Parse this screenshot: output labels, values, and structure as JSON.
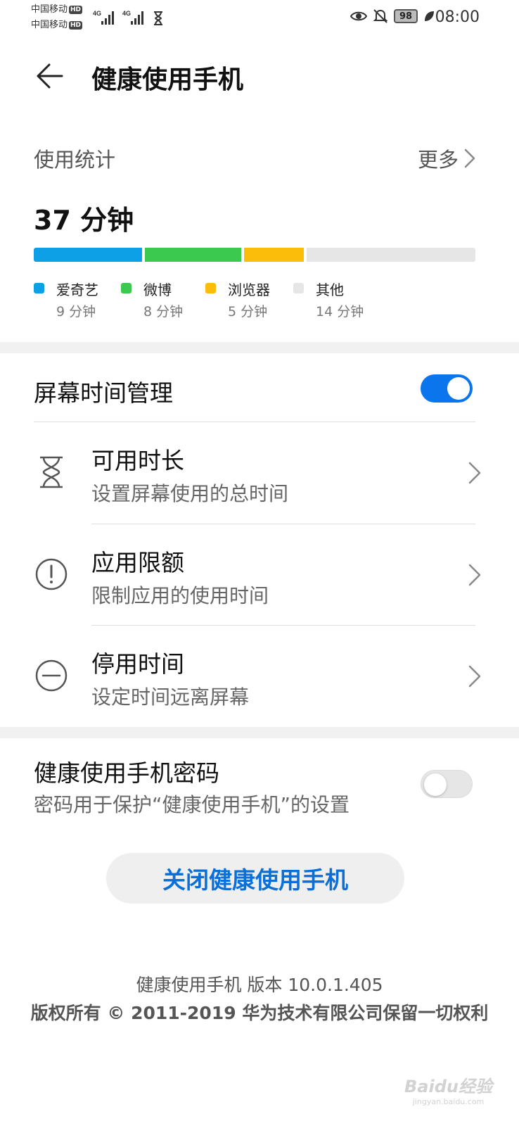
{
  "status_bar": {
    "carrier_1": "中国移动",
    "carrier_2": "中国移动",
    "hd_badge": "HD",
    "net_type": "4G",
    "battery": "98",
    "time": "08:00",
    "icons": [
      "signal-icon",
      "hourglass-icon",
      "eye-icon",
      "bell-off-icon",
      "battery-icon",
      "leaf-icon"
    ]
  },
  "header": {
    "title": "健康使用手机",
    "back_icon": "arrow-left-icon"
  },
  "usage": {
    "label": "使用统计",
    "more_label": "更多",
    "total": "37 分钟",
    "apps": [
      {
        "name": "爱奇艺",
        "time": "9 分钟",
        "minutes": 9,
        "color": "#0ea0e6"
      },
      {
        "name": "微博",
        "time": "8 分钟",
        "minutes": 8,
        "color": "#3cc94f"
      },
      {
        "name": "浏览器",
        "time": "5 分钟",
        "minutes": 5,
        "color": "#fbbd0a"
      },
      {
        "name": "其他",
        "time": "14 分钟",
        "minutes": 14,
        "color": "#e6e6e6"
      }
    ]
  },
  "screen_time": {
    "label": "屏幕时间管理",
    "enabled": true,
    "items": [
      {
        "title": "可用时长",
        "subtitle": "设置屏幕使用的总时间",
        "icon": "hourglass-icon"
      },
      {
        "title": "应用限额",
        "subtitle": "限制应用的使用时间",
        "icon": "exclamation-circle-icon"
      },
      {
        "title": "停用时间",
        "subtitle": "设定时间远离屏幕",
        "icon": "minus-circle-icon"
      }
    ]
  },
  "password": {
    "title": "健康使用手机密码",
    "subtitle": "密码用于保护“健康使用手机”的设置",
    "enabled": false
  },
  "disable_button": "关闭健康使用手机",
  "footer": {
    "version": "健康使用手机 版本 10.0.1.405",
    "copyright": "版权所有 © 2011-2019 华为技术有限公司保留一切权利"
  },
  "watermark": {
    "text": "Baidu经验",
    "sub": "jingyan.baidu.com"
  },
  "colors": {
    "accent": "#0a75ec",
    "button_text": "#0a6fd6"
  }
}
